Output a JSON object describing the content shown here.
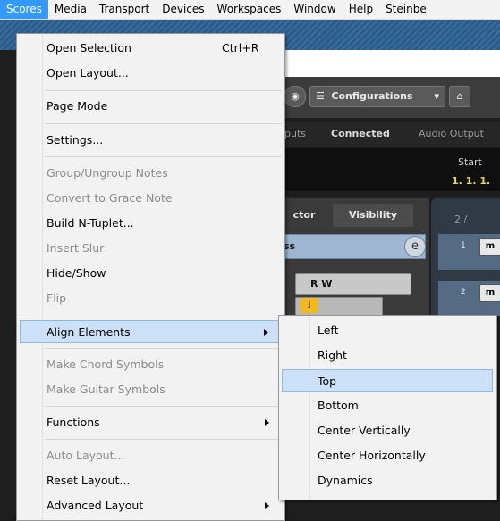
{
  "menubar": {
    "items": [
      "Scores",
      "Media",
      "Transport",
      "Devices",
      "Workspaces",
      "Window",
      "Help",
      "Steinbe"
    ],
    "active_index": 0
  },
  "background": {
    "configurations": "Configurations",
    "sub": [
      "puts",
      "Connected",
      "Audio Output"
    ],
    "start_label": "Start",
    "start_value": "1. 1. 1.",
    "tabs": [
      "ctor",
      "Visibility"
    ],
    "preset_text": "ss",
    "e_button": "e",
    "rw": "R  W",
    "track_header": "2 /",
    "track1_num": "1",
    "track2_num": "2",
    "m_label": "m"
  },
  "menu": {
    "items": [
      {
        "label": "Open Selection",
        "shortcut": "Ctrl+R",
        "disabled": false
      },
      {
        "label": "Open Layout...",
        "shortcut": "",
        "disabled": false
      },
      {
        "label": "Page Mode",
        "shortcut": "",
        "disabled": false
      },
      {
        "label": "Settings...",
        "shortcut": "",
        "disabled": false
      },
      {
        "label": "Group/Ungroup Notes",
        "shortcut": "",
        "disabled": true
      },
      {
        "label": "Convert to Grace Note",
        "shortcut": "",
        "disabled": true
      },
      {
        "label": "Build N-Tuplet...",
        "shortcut": "",
        "disabled": false
      },
      {
        "label": "Insert Slur",
        "shortcut": "",
        "disabled": true
      },
      {
        "label": "Hide/Show",
        "shortcut": "",
        "disabled": false
      },
      {
        "label": "Flip",
        "shortcut": "",
        "disabled": true
      },
      {
        "label": "Align Elements",
        "shortcut": "",
        "disabled": false,
        "submenu": true,
        "highlighted": true
      },
      {
        "label": "Make Chord Symbols",
        "shortcut": "",
        "disabled": true
      },
      {
        "label": "Make Guitar Symbols",
        "shortcut": "",
        "disabled": true
      },
      {
        "label": "Functions",
        "shortcut": "",
        "disabled": false,
        "submenu": true
      },
      {
        "label": "Auto Layout...",
        "shortcut": "",
        "disabled": true
      },
      {
        "label": "Reset Layout...",
        "shortcut": "",
        "disabled": false
      },
      {
        "label": "Advanced Layout",
        "shortcut": "",
        "disabled": false,
        "submenu": true
      }
    ]
  },
  "submenu": {
    "items": [
      "Left",
      "Right",
      "Top",
      "Bottom",
      "Center Vertically",
      "Center Horizontally",
      "Dynamics"
    ],
    "highlighted_index": 2
  }
}
